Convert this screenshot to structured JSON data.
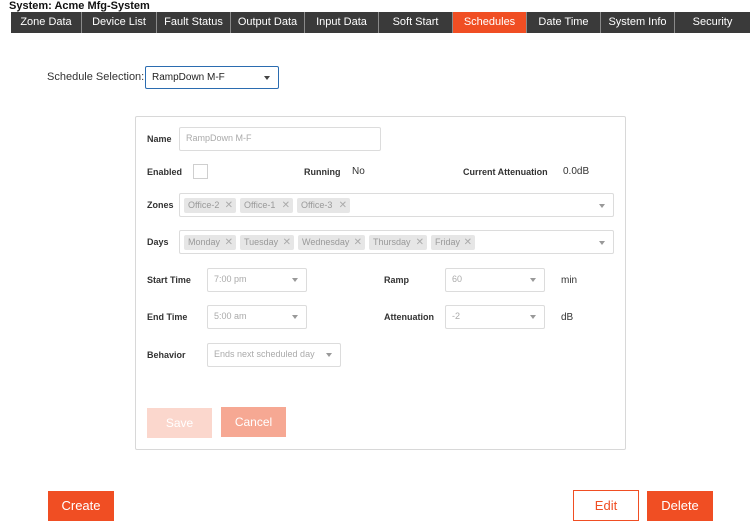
{
  "system_title": "System: Acme Mfg-System",
  "tabs": [
    {
      "label": "Zone Data",
      "active": false
    },
    {
      "label": "Device List",
      "active": false
    },
    {
      "label": "Fault Status",
      "active": false
    },
    {
      "label": "Output Data",
      "active": false
    },
    {
      "label": "Input Data",
      "active": false
    },
    {
      "label": "Soft Start",
      "active": false
    },
    {
      "label": "Schedules",
      "active": true
    },
    {
      "label": "Date Time",
      "active": false
    },
    {
      "label": "System Info",
      "active": false
    },
    {
      "label": "Security",
      "active": false
    }
  ],
  "schedule_selection": {
    "label": "Schedule Selection:",
    "value": "RampDown M-F"
  },
  "form": {
    "name_label": "Name",
    "name_placeholder": "RampDown M-F",
    "enabled_label": "Enabled",
    "running_label": "Running",
    "running_value": "No",
    "attenuation_current_label": "Current Attenuation",
    "attenuation_current_value": "0.0dB",
    "zones_label": "Zones",
    "zones": [
      "Office-2",
      "Office-1",
      "Office-3"
    ],
    "days_label": "Days",
    "days": [
      "Monday",
      "Tuesday",
      "Wednesday",
      "Thursday",
      "Friday"
    ],
    "start_time_label": "Start Time",
    "start_time_value": "7:00 pm",
    "ramp_label": "Ramp",
    "ramp_value": "60",
    "ramp_unit": "min",
    "end_time_label": "End Time",
    "end_time_value": "5:00 am",
    "attenuation_label": "Attenuation",
    "attenuation_value": "-2",
    "attenuation_unit": "dB",
    "behavior_label": "Behavior",
    "behavior_value": "Ends next scheduled day",
    "save_label": "Save",
    "cancel_label": "Cancel"
  },
  "actions": {
    "create_label": "Create",
    "edit_label": "Edit",
    "delete_label": "Delete"
  },
  "colors": {
    "accent": "#f04e23",
    "tab_bar": "#3a3a3a",
    "focus_border": "#2b6cb0"
  }
}
